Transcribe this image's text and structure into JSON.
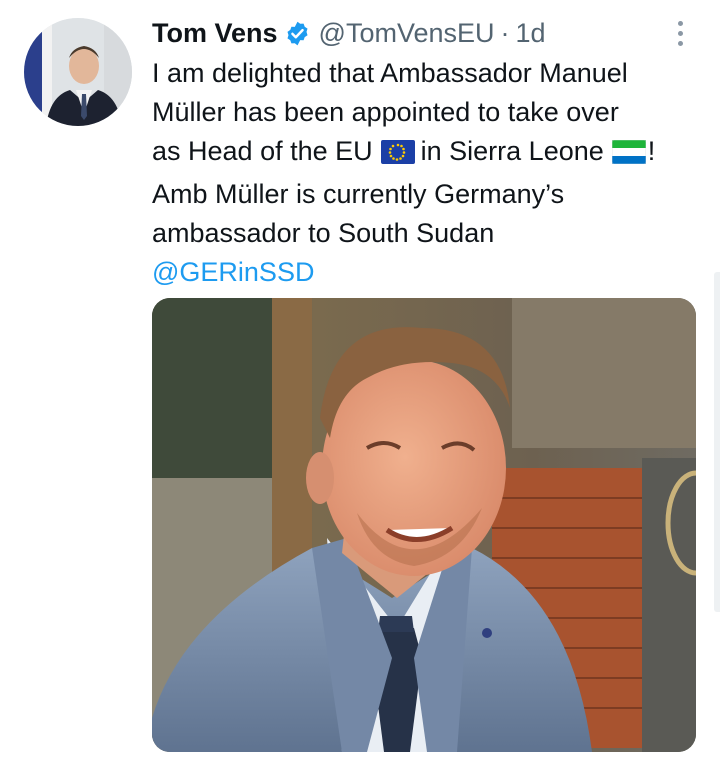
{
  "tweet": {
    "author_name": "Tom Vens",
    "handle": "@TomVensEU",
    "separator": "·",
    "time_ago": "1d",
    "verified": true,
    "text": {
      "line1": "I am delighted that Ambassador Manuel",
      "line2": "Müller has been appointed to take over",
      "line3_a": "as Head of the EU",
      "line3_b": "in Sierra Leone",
      "line3_c": "!",
      "line4": "Amb Müller is currently Germany’s",
      "line5": "ambassador to South Sudan"
    },
    "mention": "@GERinSSD",
    "flags": [
      "eu-flag-icon",
      "sierra-leone-flag-icon"
    ],
    "media": {
      "type": "photo"
    }
  },
  "colors": {
    "text": "#0f1419",
    "secondary": "#536471",
    "link": "#1d9bf0",
    "verified": "#1d9bf0"
  }
}
